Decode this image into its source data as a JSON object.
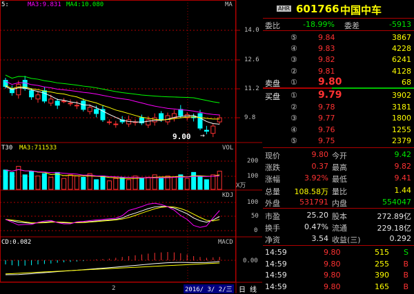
{
  "main_chart": {
    "legend_prefix": "5:",
    "ma3": "MA3:9.831",
    "ma4": "MA4:10.080",
    "tag": "MA",
    "y_ticks": [
      "14.0",
      "12.6",
      "11.2",
      "9.8"
    ],
    "low_marker": "9.00",
    "low_arrow": "→"
  },
  "vol_chart": {
    "legend_prefix": "T30",
    "ma3": "MA3:711533",
    "tag": "VOL",
    "y_ticks": [
      "200",
      "100"
    ],
    "unit": "X万"
  },
  "kdj_chart": {
    "tag": "KDJ",
    "y_ticks": [
      "100",
      "50",
      "0"
    ]
  },
  "macd_chart": {
    "legend": "CD:0.082",
    "tag": "MACD",
    "y_ticks": [
      "0.00"
    ]
  },
  "bottom_bar": {
    "marker": "2",
    "date": "2016/ 3/ 2/三",
    "tab_day": "日",
    "tab_line": "线"
  },
  "quote": {
    "badge": "AHR",
    "code": "601766",
    "name": "中国中车",
    "webi_label": "委比",
    "webi_value": "-18.99%",
    "weicha_label": "委差",
    "weicha_value": "-5913",
    "sell_label": "卖盘",
    "buy_label": "买盘",
    "sell": [
      {
        "num": "⑤",
        "price": "9.84",
        "vol": "3867"
      },
      {
        "num": "④",
        "price": "9.83",
        "vol": "4228"
      },
      {
        "num": "③",
        "price": "9.82",
        "vol": "6241"
      },
      {
        "num": "②",
        "price": "9.81",
        "vol": "4128"
      },
      {
        "num": "①",
        "price": "9.80",
        "vol": "68"
      }
    ],
    "buy": [
      {
        "num": "①",
        "price": "9.79",
        "vol": "3902"
      },
      {
        "num": "②",
        "price": "9.78",
        "vol": "3181"
      },
      {
        "num": "③",
        "price": "9.77",
        "vol": "1800"
      },
      {
        "num": "④",
        "price": "9.76",
        "vol": "1255"
      },
      {
        "num": "⑤",
        "price": "9.75",
        "vol": "2379"
      }
    ],
    "stats": [
      {
        "l1": "现价",
        "v1": "9.80",
        "l2": "今开",
        "v2": "9.42"
      },
      {
        "l1": "涨跌",
        "v1": "0.37",
        "l2": "最高",
        "v2": "9.82"
      },
      {
        "l1": "涨幅",
        "v1": "3.92%",
        "l2": "最低",
        "v2": "9.41"
      },
      {
        "l1": "总量",
        "v1": "108.58万",
        "l2": "量比",
        "v2": "1.44"
      },
      {
        "l1": "外盘",
        "v1": "531791",
        "l2": "内盘",
        "v2": "554047"
      }
    ],
    "stats2": [
      {
        "l1": "市盈",
        "v1": "25.20",
        "l2": "股本",
        "v2": "272.89亿"
      },
      {
        "l1": "换手",
        "v1": "0.47%",
        "l2": "流通",
        "v2": "229.18亿"
      },
      {
        "l1": "净资",
        "v1": "3.54",
        "l2": "收益(三)",
        "v2": "0.292"
      }
    ],
    "ticks": [
      {
        "time": "14:59",
        "price": "9.80",
        "vol": "515",
        "side": "S"
      },
      {
        "time": "14:59",
        "price": "9.80",
        "vol": "255",
        "side": "B"
      },
      {
        "time": "14:59",
        "price": "9.80",
        "vol": "390",
        "side": "B"
      },
      {
        "time": "14:59",
        "price": "9.80",
        "vol": "165",
        "side": "B"
      }
    ]
  },
  "colors": {
    "up": "#ff3232",
    "down": "#00ffff",
    "ma1": "#ffffff",
    "ma2": "#ffff00",
    "ma3": "#ff00ff",
    "ma4": "#00ff00",
    "grid": "#b00000"
  }
}
